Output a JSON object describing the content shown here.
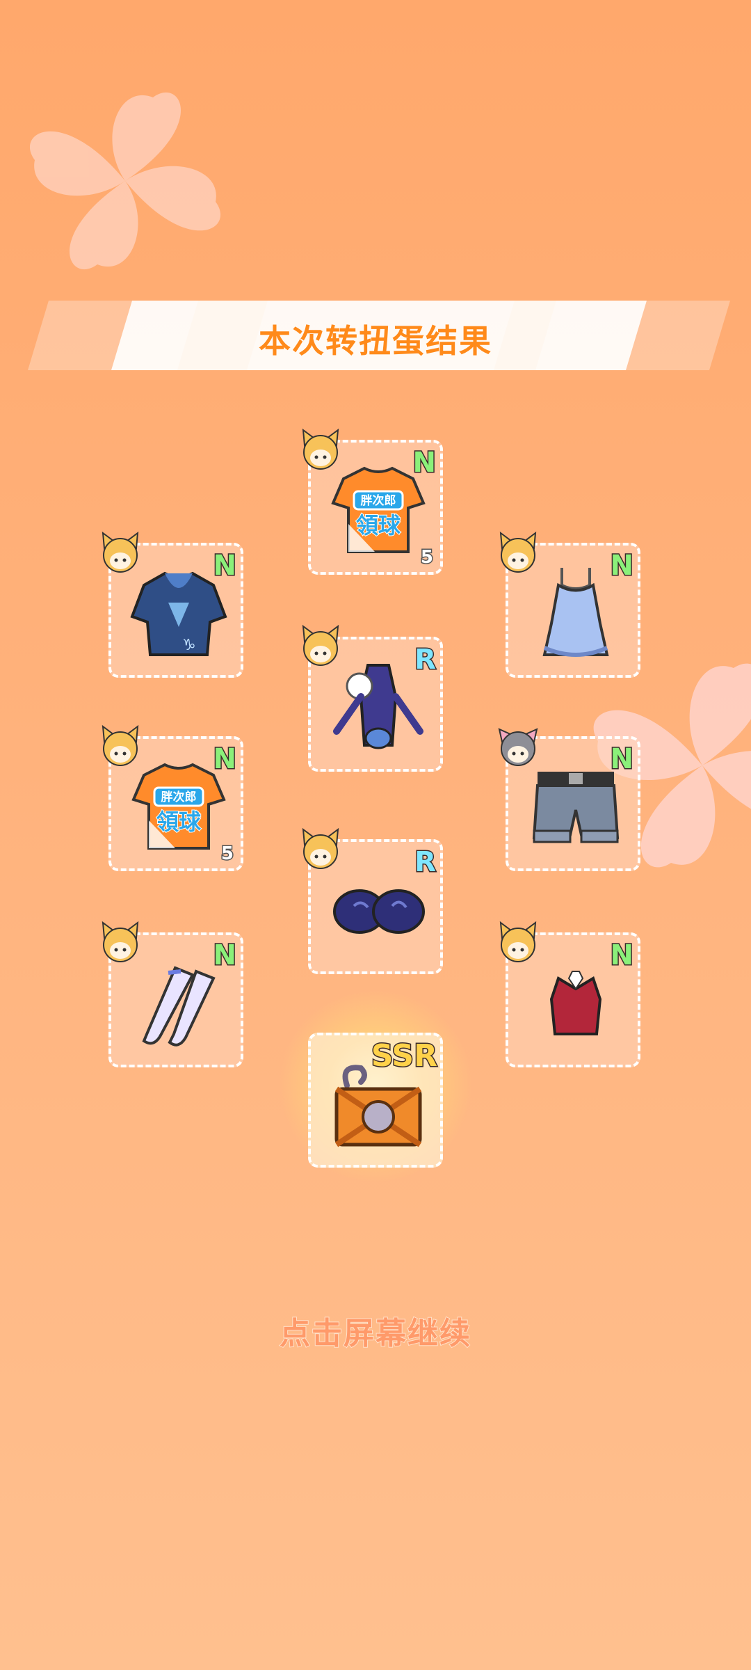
{
  "header": {
    "title": "本次转扭蛋结果"
  },
  "footer": {
    "continue_text": "点击屏幕继续"
  },
  "items": [
    {
      "id": "orange-tshirt-top",
      "rarity": "N",
      "count": "5",
      "shirt_text_1": "胖次郎",
      "shirt_text_2": "領球",
      "avatar": "blonde-cat-girl"
    },
    {
      "id": "blue-tshirt",
      "rarity": "N",
      "avatar": "blonde-cat-girl"
    },
    {
      "id": "blue-dress",
      "rarity": "N",
      "avatar": "blonde-cat-girl"
    },
    {
      "id": "purple-outfit",
      "rarity": "R",
      "avatar": "blonde-cat-girl"
    },
    {
      "id": "orange-tshirt-left",
      "rarity": "N",
      "count": "5",
      "shirt_text_1": "胖次郎",
      "shirt_text_2": "領球",
      "avatar": "blonde-cat-girl"
    },
    {
      "id": "denim-shorts",
      "rarity": "N",
      "avatar": "gray-hair-girl"
    },
    {
      "id": "navy-gloves",
      "rarity": "R",
      "avatar": "blonde-cat-girl"
    },
    {
      "id": "white-stockings",
      "rarity": "N",
      "avatar": "blonde-cat-girl"
    },
    {
      "id": "red-vest",
      "rarity": "N",
      "avatar": "blonde-cat-girl"
    },
    {
      "id": "ssr-chest",
      "rarity": "SSR"
    }
  ],
  "colors": {
    "background": "#ffa86c",
    "title": "#ff8a1a",
    "rarity_n": "#8bf07a",
    "rarity_r": "#7fe6ff",
    "rarity_ssr": "#ffd24a"
  }
}
